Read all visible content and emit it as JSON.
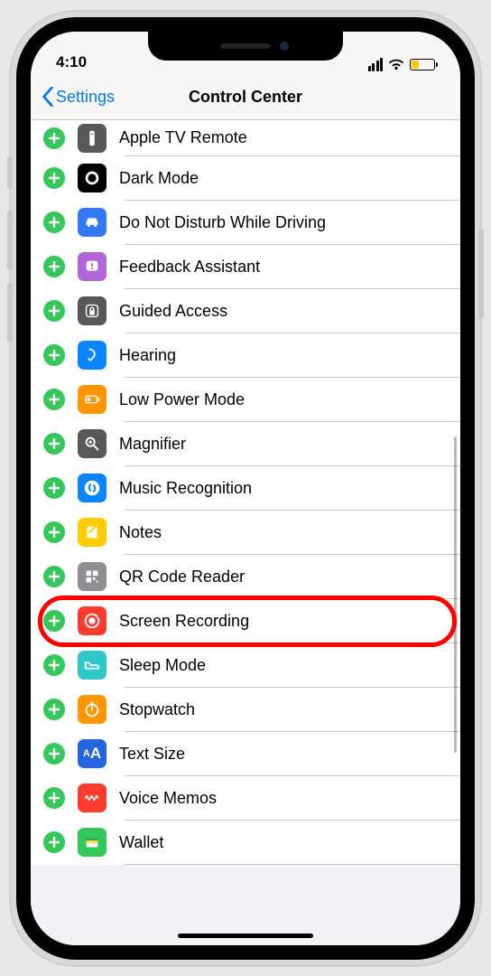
{
  "status": {
    "time": "4:10"
  },
  "nav": {
    "back": "Settings",
    "title": "Control Center"
  },
  "rows": [
    {
      "label": "Apple TV Remote",
      "icon_bg": "#585858",
      "icon_key": "remote"
    },
    {
      "label": "Dark Mode",
      "icon_bg": "#000000",
      "icon_key": "darkmode"
    },
    {
      "label": "Do Not Disturb While Driving",
      "icon_bg": "#3478f6",
      "icon_key": "car"
    },
    {
      "label": "Feedback Assistant",
      "icon_bg": "#b065d8",
      "icon_key": "feedback"
    },
    {
      "label": "Guided Access",
      "icon_bg": "#585858",
      "icon_key": "lock"
    },
    {
      "label": "Hearing",
      "icon_bg": "#0a84ff",
      "icon_key": "ear"
    },
    {
      "label": "Low Power Mode",
      "icon_bg": "#ff9500",
      "icon_key": "lowbatt"
    },
    {
      "label": "Magnifier",
      "icon_bg": "#585858",
      "icon_key": "magnify"
    },
    {
      "label": "Music Recognition",
      "icon_bg": "#0a84ff",
      "icon_key": "shazam"
    },
    {
      "label": "Notes",
      "icon_bg": "#ffcc00",
      "icon_key": "notes"
    },
    {
      "label": "QR Code Reader",
      "icon_bg": "#8e8e93",
      "icon_key": "qr"
    },
    {
      "label": "Screen Recording",
      "icon_bg": "#ff3b30",
      "icon_key": "record",
      "highlighted": true
    },
    {
      "label": "Sleep Mode",
      "icon_bg": "#2ec8c8",
      "icon_key": "bed"
    },
    {
      "label": "Stopwatch",
      "icon_bg": "#ff9500",
      "icon_key": "stopwatch"
    },
    {
      "label": "Text Size",
      "icon_bg": "#2466e0",
      "icon_key": "textsize"
    },
    {
      "label": "Voice Memos",
      "icon_bg": "#ff3b30",
      "icon_key": "wave"
    },
    {
      "label": "Wallet",
      "icon_bg": "#34c759",
      "icon_key": "wallet"
    }
  ]
}
